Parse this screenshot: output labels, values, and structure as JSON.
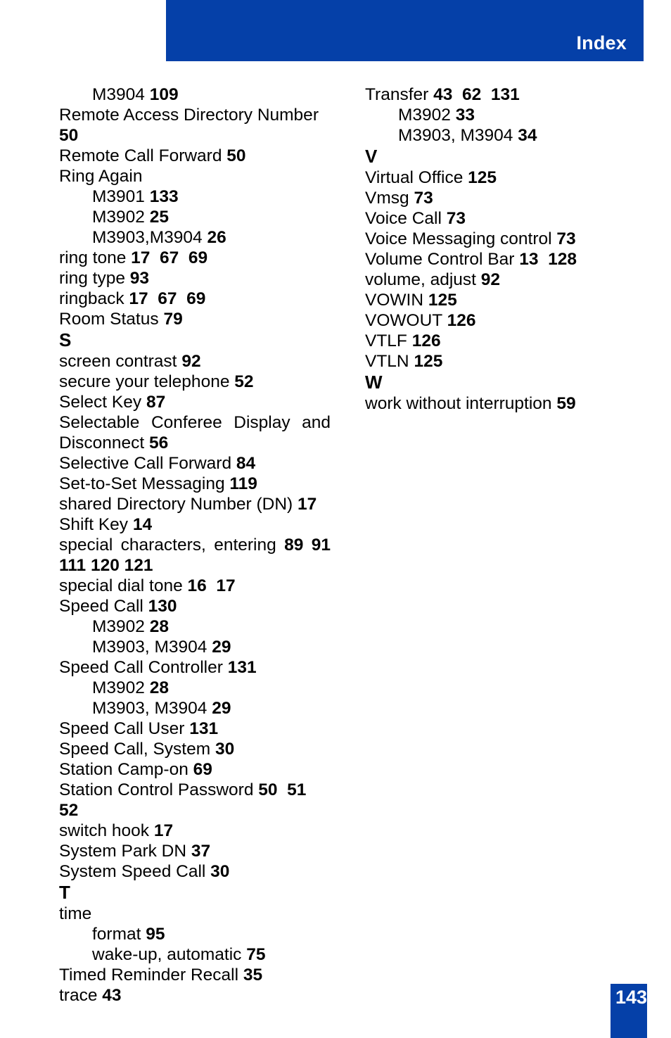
{
  "header": {
    "title": "Index",
    "bar_color": "#0540a8"
  },
  "footer": {
    "page_number": "143",
    "badge_color": "#0540a8"
  },
  "columns": {
    "left": [
      {
        "kind": "sub",
        "text": "M3904 ",
        "pages": "109"
      },
      {
        "kind": "entry",
        "text": "Remote Access Directory Number ",
        "pages": "50"
      },
      {
        "kind": "entry",
        "text": "Remote Call Forward ",
        "pages": "50"
      },
      {
        "kind": "entry",
        "text": "Ring Again",
        "pages": ""
      },
      {
        "kind": "sub",
        "text": "M3901 ",
        "pages": "133"
      },
      {
        "kind": "sub",
        "text": "M3902 ",
        "pages": "25"
      },
      {
        "kind": "sub",
        "text": "M3903,M3904 ",
        "pages": "26"
      },
      {
        "kind": "entry",
        "text": "ring tone ",
        "pages": "17  67  69"
      },
      {
        "kind": "entry",
        "text": "ring type ",
        "pages": "93"
      },
      {
        "kind": "entry",
        "text": "ringback ",
        "pages": "17  67  69"
      },
      {
        "kind": "entry",
        "text": "Room Status ",
        "pages": "79"
      },
      {
        "kind": "letter",
        "text": "S",
        "pages": ""
      },
      {
        "kind": "entry",
        "text": "screen contrast ",
        "pages": "92"
      },
      {
        "kind": "entry",
        "text": "secure your telephone ",
        "pages": "52"
      },
      {
        "kind": "entry",
        "text": "Select Key ",
        "pages": "87"
      },
      {
        "kind": "justify",
        "text": "Selectable Conferee Display and Disconnect ",
        "pages": "56"
      },
      {
        "kind": "entry",
        "text": "Selective Call Forward ",
        "pages": "84"
      },
      {
        "kind": "entry",
        "text": "Set-to-Set Messaging ",
        "pages": "119"
      },
      {
        "kind": "entry",
        "text": "shared Directory Number (DN) ",
        "pages": "17"
      },
      {
        "kind": "entry",
        "text": "Shift Key ",
        "pages": "14"
      },
      {
        "kind": "justify",
        "text": "special characters, entering ",
        "pages": "89  91 111  120  121"
      },
      {
        "kind": "entry",
        "text": "special dial tone ",
        "pages": "16  17"
      },
      {
        "kind": "entry",
        "text": "Speed Call ",
        "pages": "130"
      },
      {
        "kind": "sub",
        "text": "M3902 ",
        "pages": "28"
      },
      {
        "kind": "sub",
        "text": "M3903, M3904 ",
        "pages": "29"
      },
      {
        "kind": "entry",
        "text": "Speed Call Controller ",
        "pages": "131"
      },
      {
        "kind": "sub",
        "text": "M3902 ",
        "pages": "28"
      },
      {
        "kind": "sub",
        "text": "M3903, M3904 ",
        "pages": "29"
      },
      {
        "kind": "entry",
        "text": "Speed Call User ",
        "pages": "131"
      },
      {
        "kind": "entry",
        "text": "Speed Call, System ",
        "pages": "30"
      },
      {
        "kind": "entry",
        "text": "Station Camp-on ",
        "pages": "69"
      },
      {
        "kind": "entry",
        "text": "Station Control Password ",
        "pages": "50  51  52"
      },
      {
        "kind": "entry",
        "text": "switch hook ",
        "pages": "17"
      },
      {
        "kind": "entry",
        "text": "System Park DN ",
        "pages": "37"
      },
      {
        "kind": "entry",
        "text": "System Speed Call ",
        "pages": "30"
      },
      {
        "kind": "letter",
        "text": "T",
        "pages": ""
      },
      {
        "kind": "entry",
        "text": "time",
        "pages": ""
      },
      {
        "kind": "sub",
        "text": "format ",
        "pages": "95"
      },
      {
        "kind": "sub",
        "text": "wake-up, automatic ",
        "pages": "75"
      },
      {
        "kind": "entry",
        "text": "Timed Reminder Recall ",
        "pages": "35"
      },
      {
        "kind": "entry",
        "text": "trace ",
        "pages": "43"
      }
    ],
    "right": [
      {
        "kind": "entry",
        "text": "Transfer ",
        "pages": "43  62  131"
      },
      {
        "kind": "sub",
        "text": "M3902 ",
        "pages": "33"
      },
      {
        "kind": "sub",
        "text": "M3903, M3904 ",
        "pages": "34"
      },
      {
        "kind": "letter",
        "text": "V",
        "pages": ""
      },
      {
        "kind": "entry",
        "text": "Virtual Office ",
        "pages": "125"
      },
      {
        "kind": "entry",
        "text": "Vmsg ",
        "pages": "73"
      },
      {
        "kind": "entry",
        "text": "Voice Call ",
        "pages": "73"
      },
      {
        "kind": "entry",
        "text": "Voice Messaging control ",
        "pages": "73"
      },
      {
        "kind": "entry",
        "text": "Volume Control Bar ",
        "pages": "13  128"
      },
      {
        "kind": "entry",
        "text": "volume, adjust ",
        "pages": "92"
      },
      {
        "kind": "entry",
        "text": "VOWIN ",
        "pages": "125"
      },
      {
        "kind": "entry",
        "text": "VOWOUT ",
        "pages": "126"
      },
      {
        "kind": "entry",
        "text": "VTLF ",
        "pages": "126"
      },
      {
        "kind": "entry",
        "text": "VTLN ",
        "pages": "125"
      },
      {
        "kind": "letter",
        "text": "W",
        "pages": ""
      },
      {
        "kind": "entry",
        "text": "work without interruption ",
        "pages": "59"
      }
    ]
  }
}
